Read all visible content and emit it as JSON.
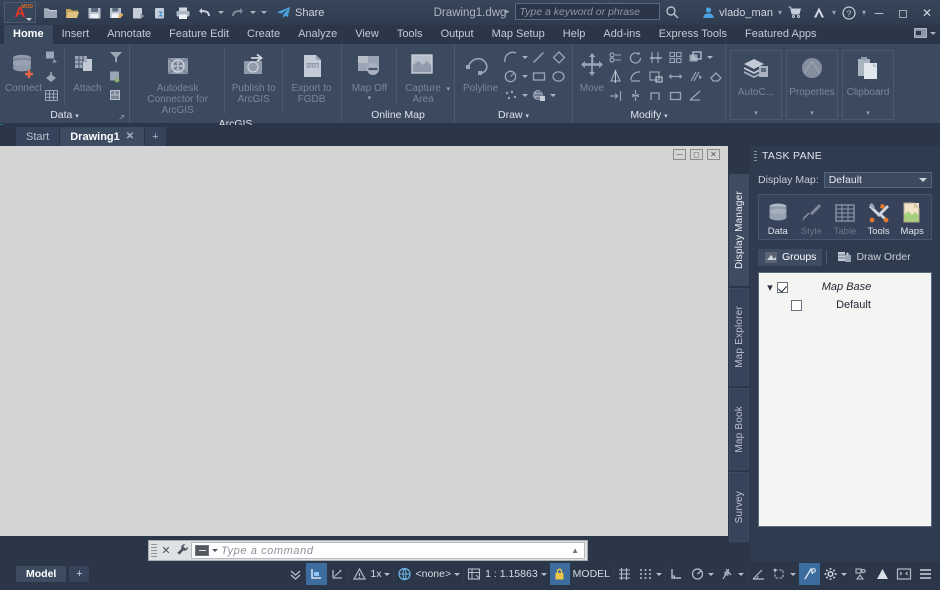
{
  "titlebar": {
    "app_badge": "A",
    "app_badge_mod": "MOD",
    "document_title": "Drawing1.dwg",
    "share_label": "Share",
    "search_placeholder": "Type a keyword or phrase",
    "user_name": "vlado_man",
    "quick_access": [
      {
        "name": "new-file-icon",
        "tip": "New"
      },
      {
        "name": "open-file-icon",
        "tip": "Open"
      },
      {
        "name": "save-icon",
        "tip": "Save"
      },
      {
        "name": "save-as-icon",
        "tip": "Save As"
      },
      {
        "name": "export-icon",
        "tip": "Export"
      },
      {
        "name": "cloud-sync-icon",
        "tip": "Sync"
      },
      {
        "name": "print-icon",
        "tip": "Plot"
      },
      {
        "name": "undo-icon",
        "tip": "Undo"
      },
      {
        "name": "redo-icon",
        "tip": "Redo"
      }
    ],
    "window_buttons": [
      "minimize",
      "maximize",
      "close"
    ]
  },
  "ribbon_tabs": [
    {
      "label": "Home",
      "active": true
    },
    {
      "label": "Insert",
      "active": false
    },
    {
      "label": "Annotate",
      "active": false
    },
    {
      "label": "Feature Edit",
      "active": false
    },
    {
      "label": "Create",
      "active": false
    },
    {
      "label": "Analyze",
      "active": false
    },
    {
      "label": "View",
      "active": false
    },
    {
      "label": "Tools",
      "active": false
    },
    {
      "label": "Output",
      "active": false
    },
    {
      "label": "Map Setup",
      "active": false
    },
    {
      "label": "Help",
      "active": false
    },
    {
      "label": "Add-ins",
      "active": false
    },
    {
      "label": "Express Tools",
      "active": false
    },
    {
      "label": "Featured Apps",
      "active": false
    }
  ],
  "ribbon_panels": {
    "data": {
      "title": "Data",
      "connect_label": "Connect",
      "attach_label": "Attach",
      "small_buttons": [
        "query-icon",
        "bulk-copy-icon",
        "data-table-icon",
        "filter-icon",
        "save-to-source-icon",
        "import-icon"
      ]
    },
    "arcgis": {
      "title": "ArcGIS",
      "buttons": [
        {
          "label": "Autodesk Connector for ArcGIS",
          "icon": "arcgis-globe-icon"
        },
        {
          "label": "Publish to ArcGIS",
          "icon": "publish-arcgis-icon"
        },
        {
          "label": "Export to FGDB",
          "icon": "fgdb-export-icon"
        }
      ]
    },
    "online_map": {
      "title": "Online Map",
      "buttons": [
        {
          "label": "Map Off",
          "icon": "map-off-icon"
        },
        {
          "label": "Capture Area",
          "icon": "capture-area-icon"
        }
      ]
    },
    "draw": {
      "title": "Draw",
      "polyline_label": "Polyline",
      "icons": [
        "arc-icon",
        "line-icon",
        "polygon-icon",
        "circle-icon",
        "rectangle-icon",
        "ellipse-icon",
        "point-icon",
        "hatch-icon"
      ]
    },
    "modify": {
      "title": "Modify",
      "move_label": "Move",
      "icons": [
        "copy-icon",
        "rotate-icon",
        "trim-icon",
        "array-icon",
        "offset-icon",
        "mirror-icon",
        "fillet-icon",
        "scale-icon",
        "stretch-icon",
        "explode-icon",
        "erase-icon",
        "extend-icon",
        "chamfer-icon",
        "break-icon",
        "join-icon"
      ]
    },
    "gallery": [
      {
        "label": "AutoC...",
        "icon": "autocad-layers-icon"
      },
      {
        "label": "Properties",
        "icon": "properties-icon"
      },
      {
        "label": "Clipboard",
        "icon": "clipboard-icon"
      }
    ]
  },
  "file_tabs": [
    {
      "label": "Start",
      "active": false,
      "closable": false
    },
    {
      "label": "Drawing1",
      "active": true,
      "closable": true
    }
  ],
  "file_tab_add": "+",
  "task_pane": {
    "title": "TASK PANE",
    "display_map_label": "Display Map:",
    "display_map_value": "Default",
    "display_map_options": [
      "Default"
    ],
    "toolbox": [
      {
        "label": "Data",
        "icon": "database-icon",
        "enabled": true
      },
      {
        "label": "Style",
        "icon": "brush-icon",
        "enabled": false
      },
      {
        "label": "Table",
        "icon": "grid-table-icon",
        "enabled": false
      },
      {
        "label": "Tools",
        "icon": "tools-wrench-icon",
        "enabled": true
      },
      {
        "label": "Maps",
        "icon": "maps-page-icon",
        "enabled": true
      }
    ],
    "tabs": [
      {
        "label": "Groups",
        "icon": "groups-icon",
        "active": true
      },
      {
        "label": "Draw Order",
        "icon": "draw-order-icon",
        "active": false
      }
    ],
    "tree": [
      {
        "label": "Map Base",
        "checked": true,
        "expanded": true,
        "level": 0,
        "italic": true
      },
      {
        "label": "Default",
        "checked": false,
        "expanded": false,
        "level": 1,
        "italic": false
      }
    ],
    "vertical_tabs": [
      {
        "label": "Display Manager",
        "active": true
      },
      {
        "label": "Map Explorer",
        "active": false
      },
      {
        "label": "Map Book",
        "active": false
      },
      {
        "label": "Survey",
        "active": false
      }
    ]
  },
  "viewport_controls": [
    "minimize",
    "restore",
    "close"
  ],
  "command_line": {
    "placeholder": "Type a command",
    "close_label": "✕",
    "wrench_icon": "wrench-icon"
  },
  "status_bar": {
    "model_tab": "Model",
    "add_layout": "+",
    "annotation_scale_value": "1x",
    "workspace_value": "<none>",
    "drawing_scale": "1 : 1.15863",
    "space_label": "MODEL",
    "items": [
      {
        "name": "layout-overflow-icon",
        "active": false
      },
      {
        "name": "model-space-icon",
        "active": true
      },
      {
        "name": "annotation-visibility-icon",
        "active": false
      },
      {
        "name": "annotation-scale-icon",
        "active": false
      },
      {
        "name": "workspace-switch-icon",
        "active": false
      },
      {
        "name": "viewport-scale-icon",
        "active": false
      },
      {
        "name": "lock-icon",
        "active": true
      },
      {
        "name": "grid-icon",
        "active": false
      },
      {
        "name": "snap-icon",
        "active": false
      },
      {
        "name": "ortho-icon",
        "active": false
      },
      {
        "name": "polar-tracking-icon",
        "active": false
      },
      {
        "name": "osnap-icon",
        "active": false
      },
      {
        "name": "angle-icon",
        "active": false
      },
      {
        "name": "object-snap-tracking-icon",
        "active": false
      },
      {
        "name": "dynamic-input-icon",
        "active": true
      },
      {
        "name": "settings-gear-icon",
        "active": false
      },
      {
        "name": "isolate-objects-icon",
        "active": false
      },
      {
        "name": "hardware-accel-icon",
        "active": false
      },
      {
        "name": "clean-screen-icon",
        "active": false
      },
      {
        "name": "customization-menu-icon",
        "active": false
      }
    ]
  },
  "colors": {
    "titlebar_bg": "#38465b",
    "ribbon_bg": "#3c4a5f",
    "window_bg": "#2b3748",
    "canvas_bg": "#d4d4d4",
    "tree_bg": "#f4f4f2",
    "accent_blue": "#3c6d9e",
    "accent_teal": "#1e6f8e",
    "text_primary": "#dfe4eb",
    "text_dim": "#7b8697",
    "logo_red": "#e2372b",
    "logo_orange": "#e06a1b"
  }
}
